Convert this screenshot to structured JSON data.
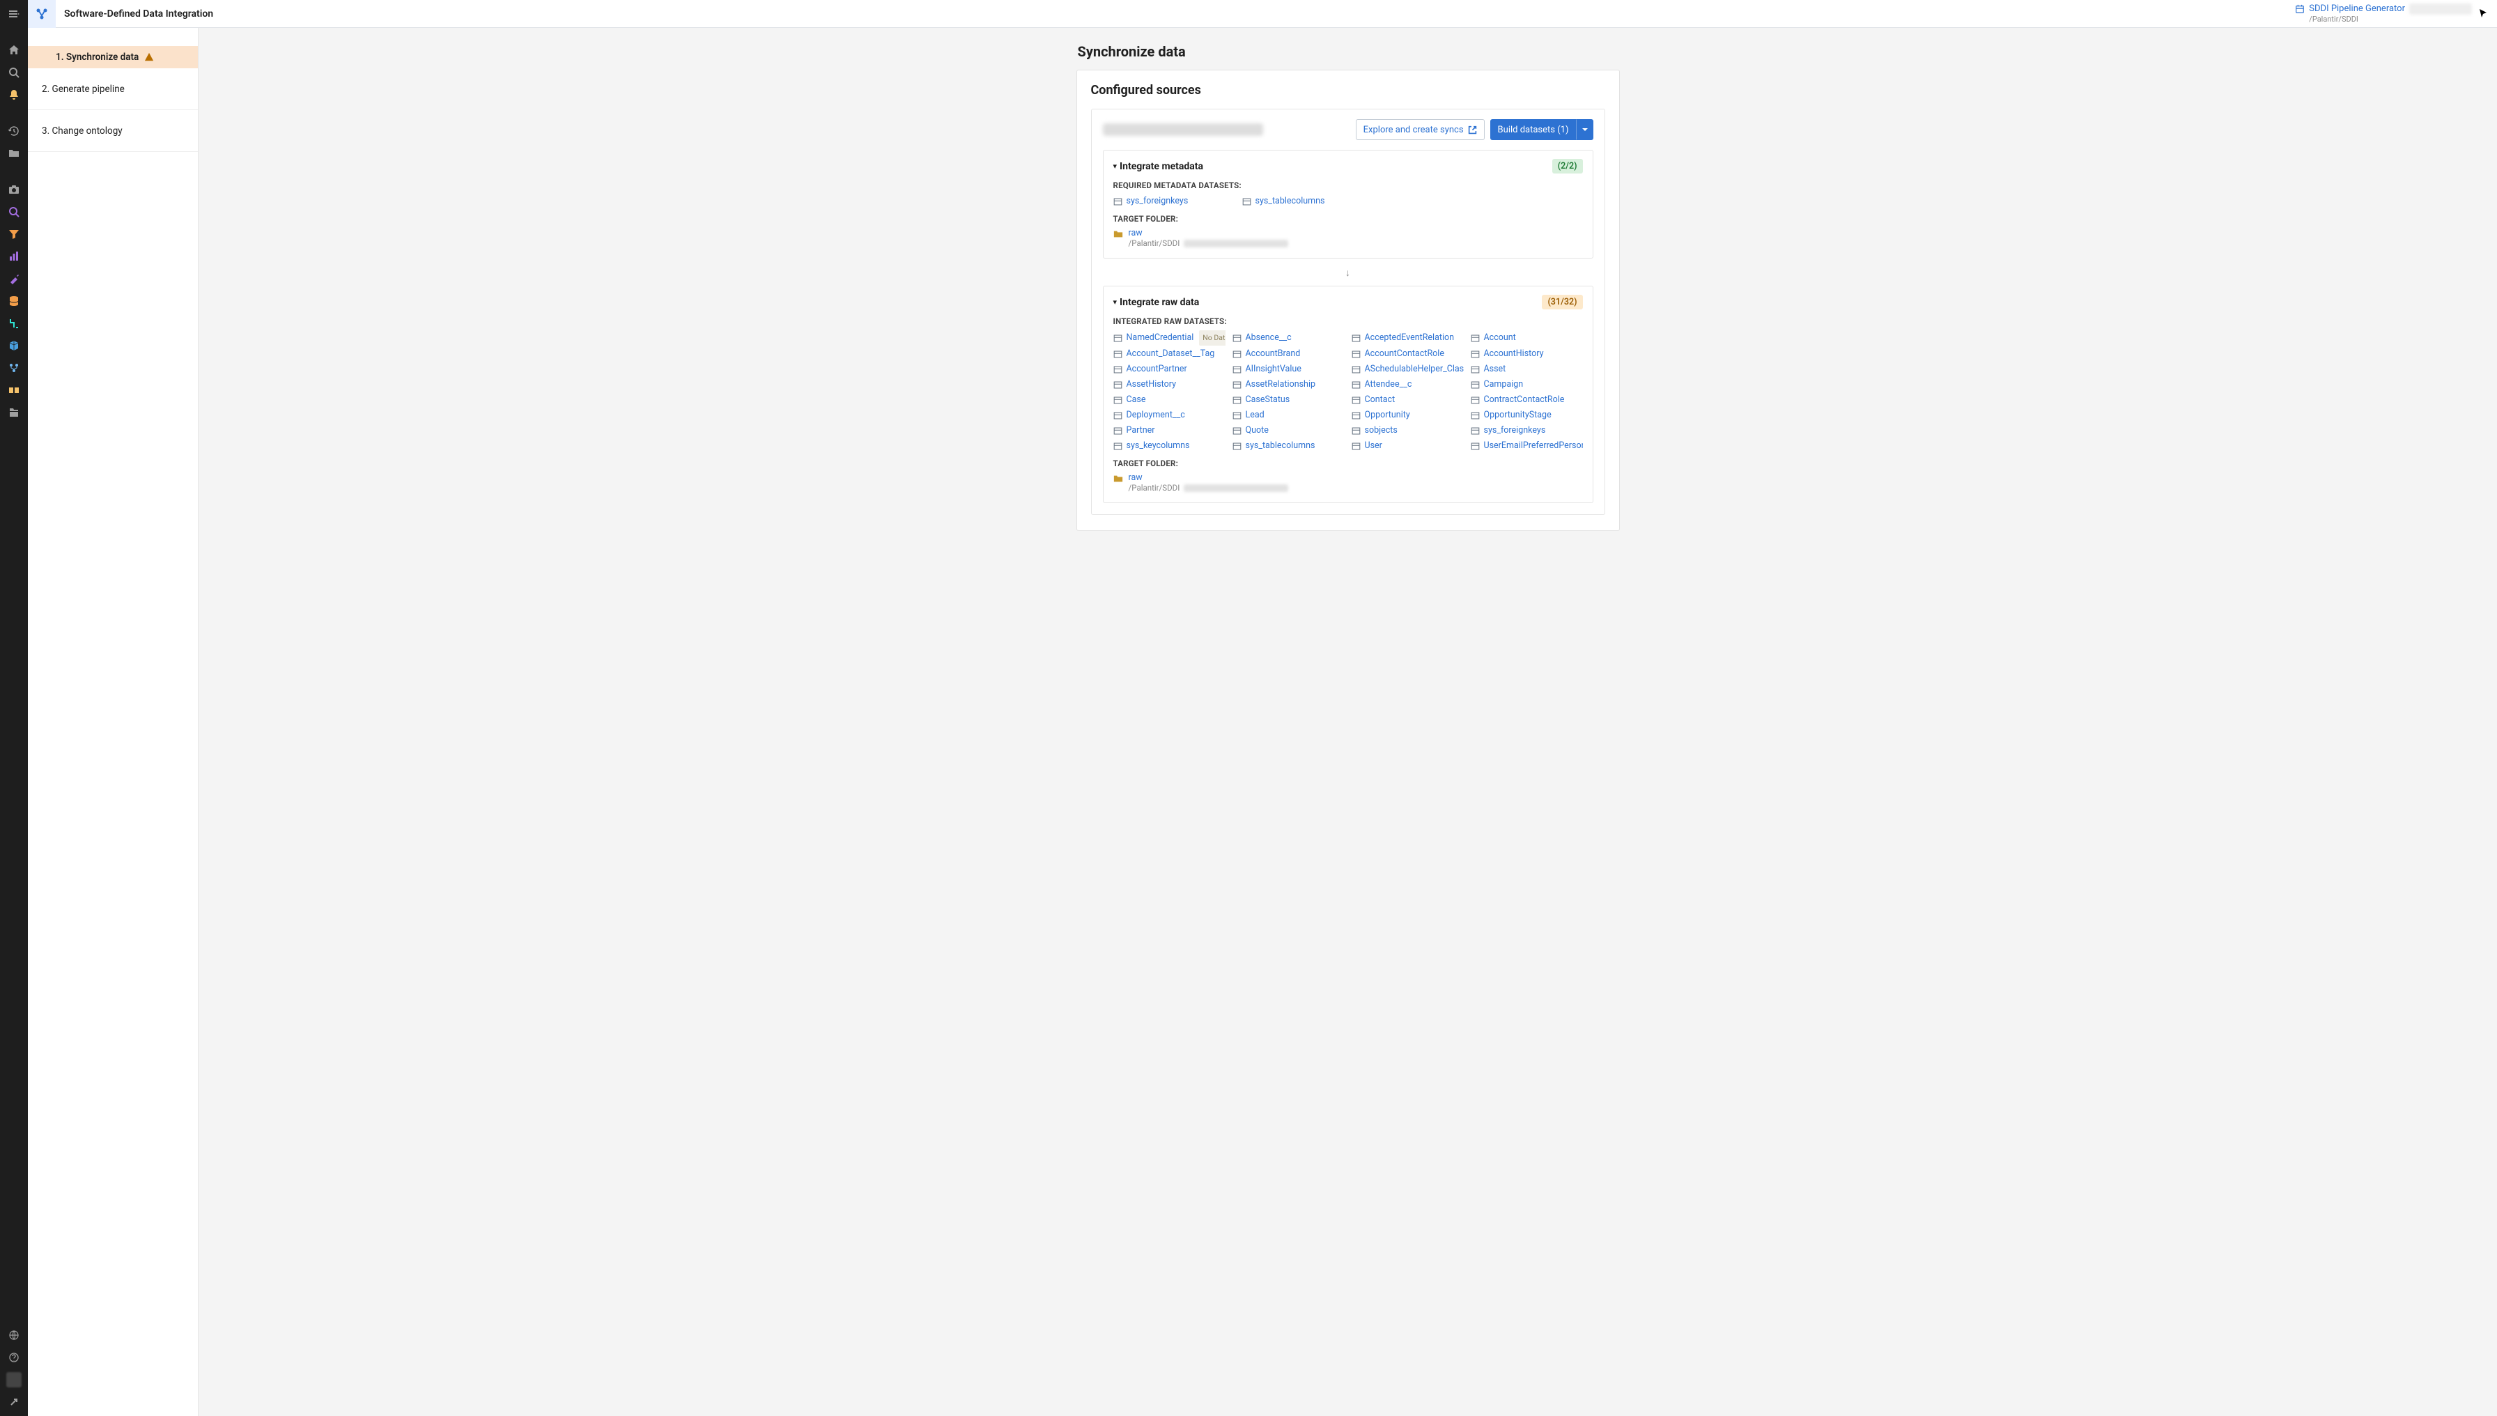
{
  "header": {
    "app_title": "Software-Defined Data Integration",
    "generator_label": "SDDI Pipeline Generator",
    "generator_path": "/Palantir/SDDI"
  },
  "steps": {
    "s1": "1. Synchronize data",
    "s2": "2. Generate pipeline",
    "s3": "3. Change ontology"
  },
  "page": {
    "title": "Synchronize data",
    "card_title": "Configured sources",
    "explore_btn": "Explore and create syncs",
    "build_btn": "Build datasets (1)"
  },
  "meta_section": {
    "title": "Integrate metadata",
    "badge": "(2/2)",
    "subhead": "REQUIRED METADATA DATASETS:",
    "target_label": "TARGET FOLDER:",
    "folder_name": "raw",
    "folder_path": "/Palantir/SDDI",
    "datasets": [
      "sys_foreignkeys",
      "sys_tablecolumns"
    ]
  },
  "raw_section": {
    "title": "Integrate raw data",
    "badge": "(31/32)",
    "subhead": "INTEGRATED RAW DATASETS:",
    "target_label": "TARGET FOLDER:",
    "folder_name": "raw",
    "folder_path": "/Palantir/SDDI",
    "no_data_tag": "No Data",
    "datasets": [
      "NamedCredential",
      "Absence__c",
      "AcceptedEventRelation",
      "Account",
      "Account_Dataset__Tag",
      "AccountBrand",
      "AccountContactRole",
      "AccountHistory",
      "AccountPartner",
      "AIInsightValue",
      "ASchedulableHelper_Class__Tag",
      "Asset",
      "AssetHistory",
      "AssetRelationship",
      "Attendee__c",
      "Campaign",
      "Case",
      "CaseStatus",
      "Contact",
      "ContractContactRole",
      "Deployment__c",
      "Lead",
      "Opportunity",
      "OpportunityStage",
      "Partner",
      "Quote",
      "sobjects",
      "sys_foreignkeys",
      "sys_keycolumns",
      "sys_tablecolumns",
      "User",
      "UserEmailPreferredPerson"
    ]
  }
}
